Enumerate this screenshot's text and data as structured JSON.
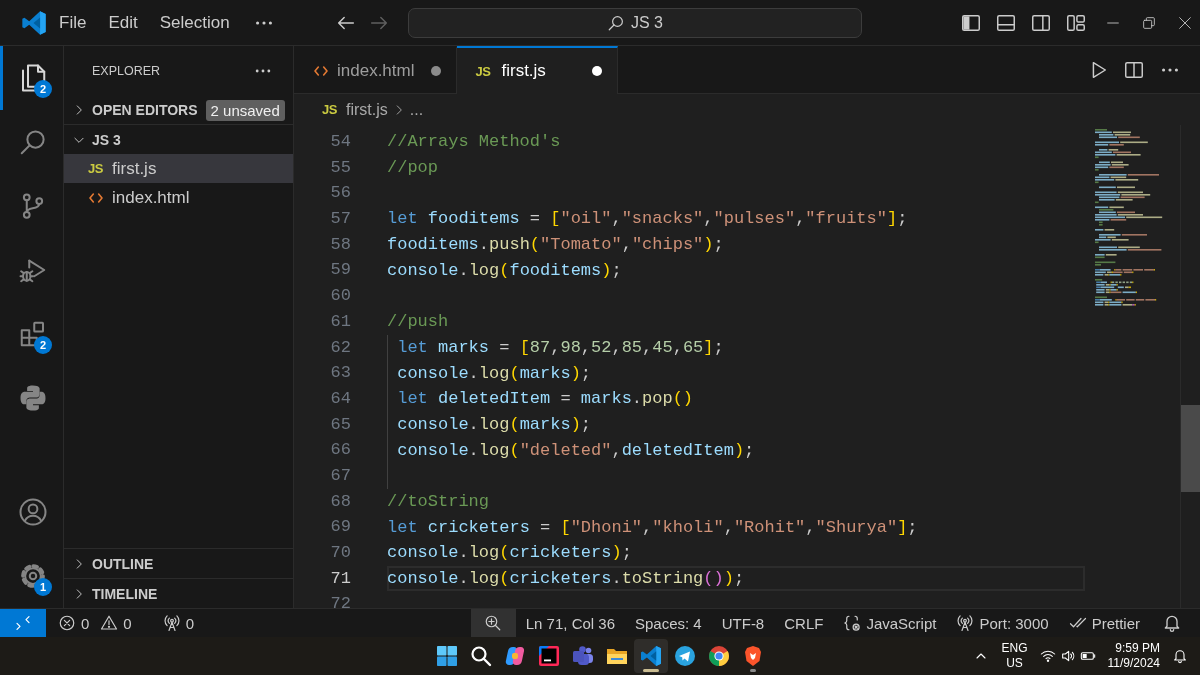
{
  "title_bar": {
    "menu": [
      "File",
      "Edit",
      "Selection"
    ],
    "nav": {
      "back": {
        "disabled": false
      },
      "forward": {
        "disabled": true
      }
    },
    "search": "JS 3"
  },
  "activity_bar": {
    "top": [
      {
        "selected": true,
        "badge": "2"
      },
      {
        "selected": false
      },
      {
        "selected": false
      },
      {
        "selected": false
      },
      {
        "selected": false,
        "badge": "2"
      },
      {
        "selected": false
      }
    ],
    "bottom": [
      {
        "selected": false
      },
      {
        "selected": false,
        "badge": "1"
      }
    ]
  },
  "sidebar": {
    "title": "EXPLORER",
    "sections": [
      {
        "label": "OPEN EDITORS",
        "expanded": false,
        "badge": "2 unsaved"
      },
      {
        "label": "JS 3",
        "expanded": true,
        "files": [
          {
            "name": "first.js",
            "kind": "js",
            "icon_text": "JS",
            "selected": true
          },
          {
            "name": "index.html",
            "kind": "html",
            "selected": false
          }
        ]
      },
      {
        "label": "OUTLINE",
        "expanded": false
      },
      {
        "label": "TIMELINE",
        "expanded": false
      }
    ]
  },
  "tabs": [
    {
      "label": "index.html",
      "kind": "html",
      "selected": false,
      "unsaved": true
    },
    {
      "label": "first.js",
      "kind": "js",
      "icon_text": "JS",
      "selected": true,
      "unsaved": true
    }
  ],
  "breadcrumbs": {
    "icon_text": "JS",
    "file": "first.js",
    "more": "..."
  },
  "editor": {
    "lines": [
      {
        "number": "54",
        "current": false,
        "indent_guide": false,
        "tokens": [
          {
            "kind": "comment",
            "text": "//Arrays Method's"
          }
        ]
      },
      {
        "number": "55",
        "current": false,
        "indent_guide": false,
        "tokens": [
          {
            "kind": "comment",
            "text": "//pop"
          }
        ]
      },
      {
        "number": "56",
        "current": false,
        "indent_guide": false
      },
      {
        "number": "57",
        "current": false,
        "indent_guide": false,
        "tokens": [
          {
            "kind": "keyword",
            "text": "let "
          },
          {
            "kind": "variable",
            "text": "fooditems"
          },
          {
            "kind": "punctuation",
            "text": " = "
          },
          {
            "kind": "bracket_outer",
            "text": "["
          },
          {
            "kind": "string",
            "text": "\"oil\""
          },
          {
            "kind": "punctuation",
            "text": ","
          },
          {
            "kind": "string",
            "text": "\"snacks\""
          },
          {
            "kind": "punctuation",
            "text": ","
          },
          {
            "kind": "string",
            "text": "\"pulses\""
          },
          {
            "kind": "punctuation",
            "text": ","
          },
          {
            "kind": "string",
            "text": "\"fruits\""
          },
          {
            "kind": "bracket_outer",
            "text": "]"
          },
          {
            "kind": "punctuation",
            "text": ";"
          }
        ]
      },
      {
        "number": "58",
        "current": false,
        "indent_guide": false,
        "tokens": [
          {
            "kind": "variable",
            "text": "fooditems"
          },
          {
            "kind": "punctuation",
            "text": "."
          },
          {
            "kind": "function",
            "text": "push"
          },
          {
            "kind": "bracket_outer",
            "text": "("
          },
          {
            "kind": "string",
            "text": "\"Tomato\""
          },
          {
            "kind": "punctuation",
            "text": ","
          },
          {
            "kind": "string",
            "text": "\"chips\""
          },
          {
            "kind": "bracket_outer",
            "text": ")"
          },
          {
            "kind": "punctuation",
            "text": ";"
          }
        ]
      },
      {
        "number": "59",
        "current": false,
        "indent_guide": false,
        "tokens": [
          {
            "kind": "variable",
            "text": "console"
          },
          {
            "kind": "punctuation",
            "text": "."
          },
          {
            "kind": "function",
            "text": "log"
          },
          {
            "kind": "bracket_outer",
            "text": "("
          },
          {
            "kind": "variable",
            "text": "fooditems"
          },
          {
            "kind": "bracket_outer",
            "text": ")"
          },
          {
            "kind": "punctuation",
            "text": ";"
          }
        ]
      },
      {
        "number": "60",
        "current": false,
        "indent_guide": false
      },
      {
        "number": "61",
        "current": false,
        "indent_guide": false,
        "tokens": [
          {
            "kind": "comment",
            "text": "//push"
          }
        ]
      },
      {
        "number": "62",
        "current": false,
        "indent_guide": true,
        "tokens": [
          {
            "kind": "keyword",
            "text": "let "
          },
          {
            "kind": "variable",
            "text": "marks"
          },
          {
            "kind": "punctuation",
            "text": " = "
          },
          {
            "kind": "bracket_outer",
            "text": "["
          },
          {
            "kind": "number",
            "text": "87"
          },
          {
            "kind": "punctuation",
            "text": ","
          },
          {
            "kind": "number",
            "text": "98"
          },
          {
            "kind": "punctuation",
            "text": ","
          },
          {
            "kind": "number",
            "text": "52"
          },
          {
            "kind": "punctuation",
            "text": ","
          },
          {
            "kind": "number",
            "text": "85"
          },
          {
            "kind": "punctuation",
            "text": ","
          },
          {
            "kind": "number",
            "text": "45"
          },
          {
            "kind": "punctuation",
            "text": ","
          },
          {
            "kind": "number",
            "text": "65"
          },
          {
            "kind": "bracket_outer",
            "text": "]"
          },
          {
            "kind": "punctuation",
            "text": ";"
          }
        ]
      },
      {
        "number": "63",
        "current": false,
        "indent_guide": true,
        "tokens": [
          {
            "kind": "variable",
            "text": "console"
          },
          {
            "kind": "punctuation",
            "text": "."
          },
          {
            "kind": "function",
            "text": "log"
          },
          {
            "kind": "bracket_outer",
            "text": "("
          },
          {
            "kind": "variable",
            "text": "marks"
          },
          {
            "kind": "bracket_outer",
            "text": ")"
          },
          {
            "kind": "punctuation",
            "text": ";"
          }
        ]
      },
      {
        "number": "64",
        "current": false,
        "indent_guide": true,
        "tokens": [
          {
            "kind": "keyword",
            "text": "let "
          },
          {
            "kind": "variable",
            "text": "deletedItem"
          },
          {
            "kind": "punctuation",
            "text": " = "
          },
          {
            "kind": "variable",
            "text": "marks"
          },
          {
            "kind": "punctuation",
            "text": "."
          },
          {
            "kind": "function",
            "text": "pop"
          },
          {
            "kind": "bracket_outer",
            "text": "()"
          }
        ]
      },
      {
        "number": "65",
        "current": false,
        "indent_guide": true,
        "tokens": [
          {
            "kind": "variable",
            "text": "console"
          },
          {
            "kind": "punctuation",
            "text": "."
          },
          {
            "kind": "function",
            "text": "log"
          },
          {
            "kind": "bracket_outer",
            "text": "("
          },
          {
            "kind": "variable",
            "text": "marks"
          },
          {
            "kind": "bracket_outer",
            "text": ")"
          },
          {
            "kind": "punctuation",
            "text": ";"
          }
        ]
      },
      {
        "number": "66",
        "current": false,
        "indent_guide": true,
        "tokens": [
          {
            "kind": "variable",
            "text": "console"
          },
          {
            "kind": "punctuation",
            "text": "."
          },
          {
            "kind": "function",
            "text": "log"
          },
          {
            "kind": "bracket_outer",
            "text": "("
          },
          {
            "kind": "string",
            "text": "\"deleted\""
          },
          {
            "kind": "punctuation",
            "text": ","
          },
          {
            "kind": "variable",
            "text": "deletedItem"
          },
          {
            "kind": "bracket_outer",
            "text": ")"
          },
          {
            "kind": "punctuation",
            "text": ";"
          }
        ]
      },
      {
        "number": "67",
        "current": false,
        "indent_guide": true
      },
      {
        "number": "68",
        "current": false,
        "indent_guide": false,
        "tokens": [
          {
            "kind": "comment",
            "text": "//toString"
          }
        ]
      },
      {
        "number": "69",
        "current": false,
        "indent_guide": false,
        "tokens": [
          {
            "kind": "keyword",
            "text": "let "
          },
          {
            "kind": "variable",
            "text": "cricketers"
          },
          {
            "kind": "punctuation",
            "text": " = "
          },
          {
            "kind": "bracket_outer",
            "text": "["
          },
          {
            "kind": "string",
            "text": "\"Dhoni\""
          },
          {
            "kind": "punctuation",
            "text": ","
          },
          {
            "kind": "string",
            "text": "\"kholi\""
          },
          {
            "kind": "punctuation",
            "text": ","
          },
          {
            "kind": "string",
            "text": "\"Rohit\""
          },
          {
            "kind": "punctuation",
            "text": ","
          },
          {
            "kind": "string",
            "text": "\"Shurya\""
          },
          {
            "kind": "bracket_outer",
            "text": "]"
          },
          {
            "kind": "punctuation",
            "text": ";"
          }
        ]
      },
      {
        "number": "70",
        "current": false,
        "indent_guide": false,
        "tokens": [
          {
            "kind": "variable",
            "text": "console"
          },
          {
            "kind": "punctuation",
            "text": "."
          },
          {
            "kind": "function",
            "text": "log"
          },
          {
            "kind": "bracket_outer",
            "text": "("
          },
          {
            "kind": "variable",
            "text": "cricketers"
          },
          {
            "kind": "bracket_outer",
            "text": ")"
          },
          {
            "kind": "punctuation",
            "text": ";"
          }
        ]
      },
      {
        "number": "71",
        "current": true,
        "indent_guide": false,
        "tokens": [
          {
            "kind": "variable",
            "text": "console"
          },
          {
            "kind": "punctuation",
            "text": "."
          },
          {
            "kind": "function",
            "text": "log"
          },
          {
            "kind": "bracket_outer",
            "text": "("
          },
          {
            "kind": "variable",
            "text": "cricketers"
          },
          {
            "kind": "punctuation",
            "text": "."
          },
          {
            "kind": "function",
            "text": "toString"
          },
          {
            "kind": "bracket_inner",
            "text": "()"
          },
          {
            "kind": "bracket_outer",
            "text": ")"
          },
          {
            "kind": "punctuation",
            "text": ";"
          }
        ]
      },
      {
        "number": "72",
        "current": false,
        "indent_guide": false
      }
    ]
  },
  "status_bar": {
    "errors": "0",
    "warnings": "0",
    "ports": "0",
    "items": [
      {
        "kind": "position",
        "text": "Ln 71, Col 36"
      },
      {
        "kind": "indentation",
        "text": "Spaces: 4"
      },
      {
        "kind": "encoding",
        "text": "UTF-8"
      },
      {
        "kind": "line_ending",
        "text": "CRLF"
      },
      {
        "kind": "language",
        "text": "JavaScript"
      },
      {
        "kind": "port",
        "text": "Port: 3000"
      },
      {
        "kind": "formatter",
        "text": "Prettier"
      }
    ]
  },
  "taskbar": {
    "apps": [
      {
        "selected": false,
        "running": false
      },
      {
        "selected": false,
        "running": false
      },
      {
        "selected": false,
        "running": false
      },
      {
        "selected": false,
        "running": false
      },
      {
        "selected": false,
        "running": false
      },
      {
        "selected": false,
        "running": false
      },
      {
        "selected": true,
        "running": true
      },
      {
        "selected": false,
        "running": false
      },
      {
        "selected": false,
        "running": false
      },
      {
        "selected": false,
        "running": true
      }
    ],
    "tray": {
      "language": "ENG",
      "region": "US",
      "time": "9:59 PM",
      "date": "11/9/2024"
    }
  }
}
